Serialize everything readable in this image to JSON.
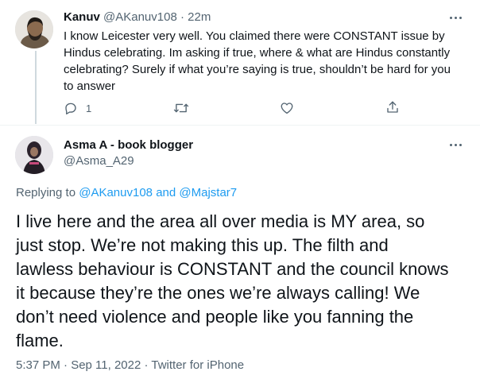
{
  "reply_tweet": {
    "display_name": "Kanuv",
    "handle": "@AKanuv108",
    "separator": "·",
    "time": "22m",
    "text_lines": [
      "I know Leicester very well. You claimed there were CONSTANT issue by",
      "Hindus celebrating. Im asking if true, where & what are Hindus constantly",
      "celebrating? Surely if what you’re saying is true, shouldn’t be hard for you",
      "to answer"
    ],
    "reply_count": "1",
    "icons": {
      "more": "more-horizontal-icon",
      "reply": "reply-icon",
      "retweet": "retweet-icon",
      "like": "like-icon",
      "share": "share-icon"
    }
  },
  "main_tweet": {
    "display_name": "Asma A - book blogger",
    "handle": "@Asma_A29",
    "replying_prefix": "Replying to",
    "replying_user1": "@AKanuv108",
    "replying_and": "and",
    "replying_user2": "@Majstar7",
    "text_lines": [
      "I live here and the area all over media is MY area, so",
      "just stop. We’re not making this up. The filth and",
      "lawless behaviour is CONSTANT and the council knows",
      "it because they’re the ones we’re always calling! We",
      "don’t need violence and people like you fanning the",
      "flame."
    ],
    "timestamp": "5:37 PM · Sep 11, 2022 · Twitter for iPhone"
  },
  "colors": {
    "accent": "#1d9bf0",
    "text": "#0f1419",
    "muted": "#536471",
    "divider": "#eff3f4"
  }
}
